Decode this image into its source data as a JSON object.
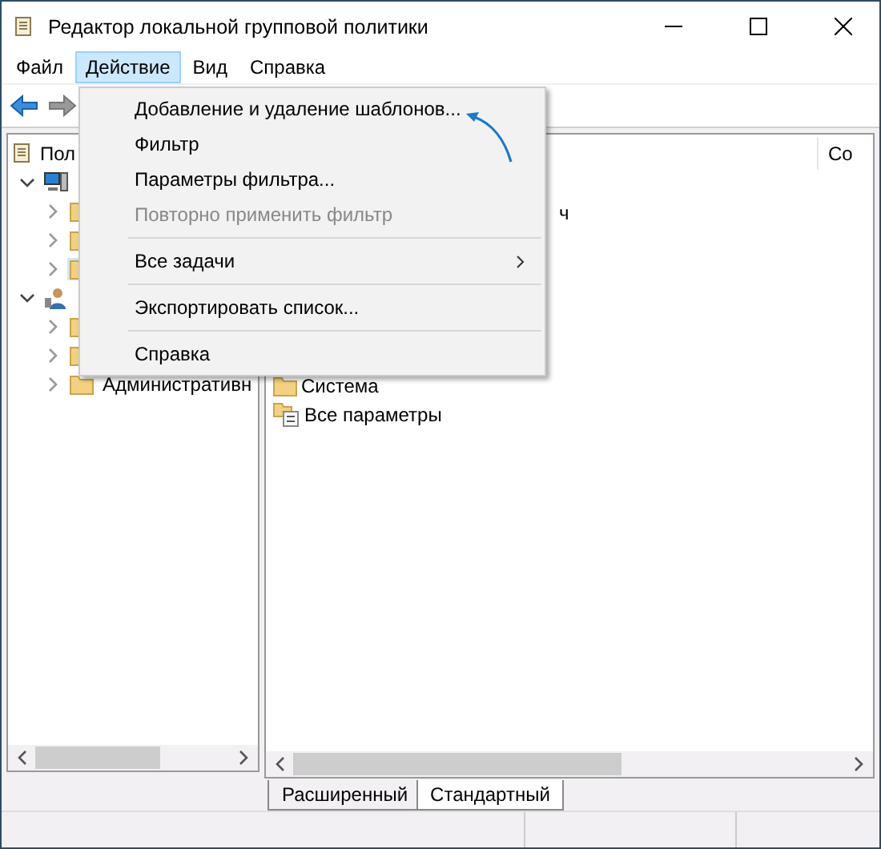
{
  "window": {
    "title": "Редактор локальной групповой политики"
  },
  "menubar": [
    {
      "label": "Файл",
      "selected": false
    },
    {
      "label": "Действие",
      "selected": true
    },
    {
      "label": "Вид",
      "selected": false
    },
    {
      "label": "Справка",
      "selected": false
    }
  ],
  "tree": [
    {
      "kind": "policy",
      "label": "Пол",
      "selected": false,
      "children": [
        {
          "kind": "computer",
          "expanded": true,
          "selected": false,
          "children": [
            {
              "kind": "folder",
              "expanded": false,
              "selected": false
            },
            {
              "kind": "folder",
              "expanded": false,
              "selected": false
            },
            {
              "kind": "folder",
              "expanded": false,
              "selected": true
            }
          ]
        },
        {
          "kind": "user",
          "expanded": true,
          "selected": false,
          "children": [
            {
              "kind": "folder",
              "expanded": false,
              "selected": false
            },
            {
              "kind": "folder",
              "expanded": false,
              "selected": false
            },
            {
              "kind": "folder",
              "label": "Административн",
              "expanded": false,
              "selected": false
            }
          ]
        }
      ]
    }
  ],
  "details": {
    "column_1": "Со",
    "items": [
      {
        "kind": "fragment",
        "label": "ч"
      },
      {
        "kind": "folder",
        "label": "Система"
      },
      {
        "kind": "settings",
        "label": "Все параметры"
      }
    ]
  },
  "context_menu": [
    {
      "kind": "item",
      "label": "Добавление и удаление шаблонов...",
      "disabled": false
    },
    {
      "kind": "item",
      "label": "Фильтр",
      "disabled": false
    },
    {
      "kind": "item",
      "label": "Параметры фильтра...",
      "disabled": false
    },
    {
      "kind": "item",
      "label": "Повторно применить фильтр",
      "disabled": true
    },
    {
      "kind": "separator"
    },
    {
      "kind": "submenu",
      "label": "Все задачи",
      "disabled": false
    },
    {
      "kind": "separator"
    },
    {
      "kind": "item",
      "label": "Экспортировать список...",
      "disabled": false
    },
    {
      "kind": "separator"
    },
    {
      "kind": "item",
      "label": "Справка",
      "disabled": false
    }
  ],
  "view_tabs": [
    {
      "label": "Расширенный",
      "selected": false
    },
    {
      "label": "Стандартный",
      "selected": true
    }
  ]
}
